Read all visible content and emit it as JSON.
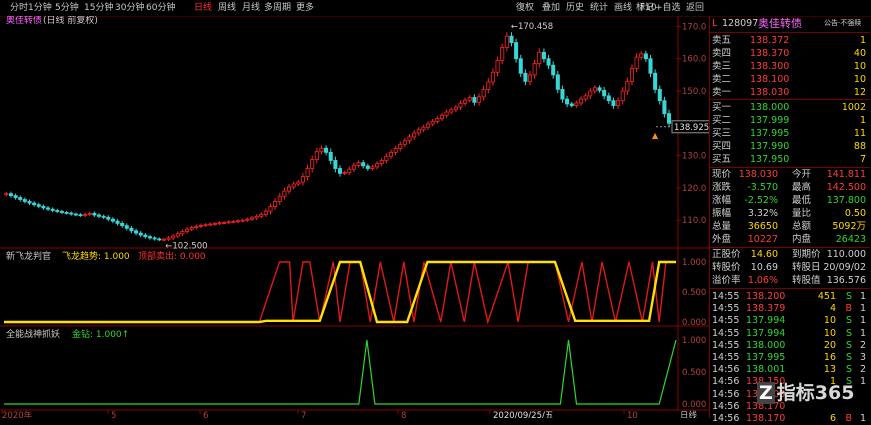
{
  "toolbar": {
    "tabs": [
      "分时",
      "1分钟",
      "5分钟",
      "15分钟",
      "30分钟",
      "60分钟",
      "日线",
      "周线",
      "月线",
      "多周期",
      "更多"
    ],
    "active_tab": "日线",
    "right": [
      "復权",
      "叠加",
      "历史",
      "统计",
      "画线",
      "F10",
      "标记",
      "+自选",
      "返回"
    ]
  },
  "main_panel": {
    "title": "奥佳转债",
    "subtitle": "(日线 前复权)"
  },
  "ind1": {
    "name": "新飞龙判官",
    "l1": "飞龙趋势: 1.000",
    "l2": "顶部卖出: 0.000",
    "axis": [
      "1.000",
      "0.500",
      "0.000"
    ]
  },
  "ind2": {
    "name": "全能战神抓妖",
    "l1": "金钻: 1.000↑",
    "axis": [
      "1.000",
      "0.500",
      "0.000"
    ]
  },
  "chart_data": {
    "type": "candlestick",
    "ylim": [
      102,
      172
    ],
    "yticks": [
      "170.0",
      "160.0",
      "150.0",
      "140.0",
      "130.0",
      "120.0",
      "110.0"
    ],
    "high_label": "170.458",
    "low_label": "102.500",
    "last_label": "138.925",
    "x_labels": [
      "2020年",
      "5",
      "6",
      "7",
      "8",
      "2020/09/25/五",
      "10"
    ],
    "close": [
      118.2,
      117.6,
      117.0,
      116.4,
      115.8,
      115.3,
      114.8,
      114.3,
      113.8,
      113.4,
      113.0,
      112.7,
      112.4,
      112.2,
      111.9,
      111.7,
      111.5,
      111.8,
      112.1,
      111.6,
      111.2,
      110.9,
      110.3,
      109.7,
      109.0,
      108.3,
      107.5,
      106.7,
      106.0,
      105.4,
      104.9,
      104.5,
      104.2,
      104.0,
      104.1,
      104.5,
      105.1,
      105.8,
      106.5,
      107.2,
      107.7,
      108.1,
      108.4,
      108.6,
      108.8,
      109.0,
      109.2,
      109.3,
      109.5,
      109.6,
      109.8,
      110.0,
      110.3,
      110.7,
      111.2,
      111.8,
      112.8,
      114.2,
      115.8,
      117.4,
      119.0,
      120.3,
      121.2,
      121.8,
      123.5,
      126.0,
      128.8,
      131.2,
      132.3,
      131.0,
      128.5,
      126.0,
      124.5,
      124.8,
      125.8,
      127.0,
      127.8,
      126.8,
      126.0,
      126.5,
      127.5,
      128.5,
      129.8,
      131.0,
      132.2,
      133.5,
      134.6,
      135.8,
      137.0,
      138.0,
      138.8,
      139.8,
      140.6,
      141.5,
      142.5,
      143.5,
      144.2,
      145.0,
      146.2,
      147.2,
      148.0,
      146.5,
      148.2,
      150.5,
      152.8,
      155.8,
      159.5,
      163.5,
      167.0,
      165.0,
      160.0,
      155.5,
      153.0,
      155.0,
      158.5,
      162.0,
      160.0,
      158.0,
      155.0,
      150.5,
      147.5,
      146.0,
      145.5,
      146.3,
      147.5,
      148.5,
      150.0,
      151.0,
      150.2,
      148.5,
      147.0,
      145.5,
      147.0,
      150.0,
      153.0,
      157.0,
      160.5,
      161.5,
      160.0,
      155.5,
      150.5,
      147.0,
      143.0,
      140.0,
      138.9
    ],
    "buy_signal": [
      0,
      0,
      0,
      0,
      0,
      0,
      0,
      0,
      0,
      0,
      0,
      0,
      0,
      0,
      0,
      0,
      0,
      0,
      0,
      0,
      0,
      0,
      0,
      0,
      0,
      0,
      0,
      0,
      0,
      0,
      0,
      0,
      0,
      0,
      0,
      0,
      0,
      0,
      0,
      0,
      0,
      0,
      0,
      0,
      0,
      0,
      0,
      0,
      0,
      0,
      0,
      0,
      0,
      0,
      0,
      0,
      0,
      0,
      0,
      0,
      0,
      0,
      0,
      0,
      0,
      0,
      0,
      0,
      0,
      0,
      0,
      0,
      0,
      0,
      0,
      0,
      0,
      0,
      0,
      0,
      0,
      0,
      0,
      0,
      0,
      0,
      0,
      0,
      0,
      0,
      0,
      0,
      0,
      0,
      0,
      0,
      0,
      0,
      0,
      0,
      0,
      0,
      0,
      0,
      0,
      0,
      0,
      0,
      0,
      0,
      0,
      0,
      0,
      0,
      0,
      0,
      0,
      0,
      0,
      0,
      0,
      0,
      0,
      0,
      0,
      0,
      0,
      0,
      0,
      0,
      0,
      0,
      0,
      0,
      0,
      0,
      0,
      0,
      0,
      0,
      0,
      0,
      0,
      0,
      1,
      1,
      1,
      1
    ]
  },
  "signals": {
    "red": [
      [
        0,
        0
      ],
      [
        0.38,
        0
      ],
      [
        0.41,
        1
      ],
      [
        0.425,
        1
      ],
      [
        0.43,
        0
      ],
      [
        0.445,
        1
      ],
      [
        0.455,
        1
      ],
      [
        0.47,
        0
      ],
      [
        0.49,
        1
      ],
      [
        0.5,
        0
      ],
      [
        0.515,
        1
      ],
      [
        0.53,
        1
      ],
      [
        0.545,
        0
      ],
      [
        0.56,
        1
      ],
      [
        0.58,
        0
      ],
      [
        0.595,
        1
      ],
      [
        0.61,
        0
      ],
      [
        0.625,
        1
      ],
      [
        0.65,
        0
      ],
      [
        0.665,
        1
      ],
      [
        0.685,
        0
      ],
      [
        0.7,
        1
      ],
      [
        0.72,
        0
      ],
      [
        0.75,
        1
      ],
      [
        0.765,
        0
      ],
      [
        0.78,
        1
      ],
      [
        0.82,
        1
      ],
      [
        0.84,
        0
      ],
      [
        0.86,
        1
      ],
      [
        0.875,
        0
      ],
      [
        0.89,
        1
      ],
      [
        0.91,
        0
      ],
      [
        0.93,
        1
      ],
      [
        0.95,
        0
      ],
      [
        0.965,
        1
      ],
      [
        0.975,
        0
      ],
      [
        0.985,
        1
      ],
      [
        1,
        1
      ]
    ],
    "yellow": [
      [
        0,
        0
      ],
      [
        0.37,
        0
      ],
      [
        0.38,
        0
      ],
      [
        0.39,
        0.02
      ],
      [
        0.47,
        0.02
      ],
      [
        0.5,
        1
      ],
      [
        0.53,
        1
      ],
      [
        0.555,
        0
      ],
      [
        0.6,
        0
      ],
      [
        0.63,
        1
      ],
      [
        0.82,
        1
      ],
      [
        0.85,
        0.02
      ],
      [
        0.96,
        0.02
      ],
      [
        0.975,
        1
      ],
      [
        1,
        1
      ]
    ],
    "green_spikes": [
      0.54,
      0.84,
      1.0
    ]
  },
  "side": {
    "code": "128097",
    "name": "奥佳转债",
    "tag": "公告·不强赎",
    "asks": [
      [
        "卖五",
        "138.372",
        "1"
      ],
      [
        "卖四",
        "138.370",
        "40"
      ],
      [
        "卖三",
        "138.300",
        "10"
      ],
      [
        "卖二",
        "138.100",
        "10"
      ],
      [
        "卖一",
        "138.030",
        "12"
      ]
    ],
    "bids": [
      [
        "买一",
        "138.000",
        "1002"
      ],
      [
        "买二",
        "137.999",
        "1"
      ],
      [
        "买三",
        "137.995",
        "11"
      ],
      [
        "买四",
        "137.990",
        "88"
      ],
      [
        "买五",
        "137.950",
        "7"
      ]
    ],
    "stats": [
      [
        "现价",
        "138.030",
        "今开",
        "141.811"
      ],
      [
        "涨跌",
        "-3.570",
        "最高",
        "142.500"
      ],
      [
        "涨幅",
        "-2.52%",
        "最低",
        "137.800"
      ],
      [
        "振幅",
        "3.32%",
        "量比",
        "0.50"
      ],
      [
        "总量",
        "36650",
        "总额",
        "5092万"
      ],
      [
        "外盘",
        "10227",
        "内盘",
        "26423"
      ]
    ],
    "bond": [
      [
        "正股价",
        "14.60",
        "到期价",
        "110.000"
      ],
      [
        "转股价",
        "10.69",
        "转股日",
        "20/09/02"
      ],
      [
        "溢价率",
        "1.06%",
        "转股值",
        "136.576"
      ]
    ],
    "ticks": [
      [
        "14:55",
        "138.200",
        "451",
        "S",
        "1"
      ],
      [
        "14:55",
        "138.379",
        "4",
        "B",
        "1"
      ],
      [
        "14:55",
        "137.994",
        "10",
        "S",
        "1"
      ],
      [
        "14:55",
        "137.994",
        "10",
        "S",
        "1"
      ],
      [
        "14:55",
        "138.000",
        "20",
        "S",
        "2"
      ],
      [
        "14:55",
        "137.995",
        "16",
        "S",
        "3"
      ],
      [
        "14:56",
        "138.001",
        "13",
        "S",
        "2"
      ],
      [
        "14:56",
        "138.150",
        "1",
        "S",
        "1"
      ],
      [
        "14:56",
        "138.100",
        "",
        "",
        ""
      ],
      [
        "14:56",
        "138.170",
        "",
        "",
        ""
      ],
      [
        "14:56",
        "138.170",
        "6",
        "B",
        "1"
      ]
    ],
    "logo": "指标365",
    "logo_mark": "Z"
  }
}
